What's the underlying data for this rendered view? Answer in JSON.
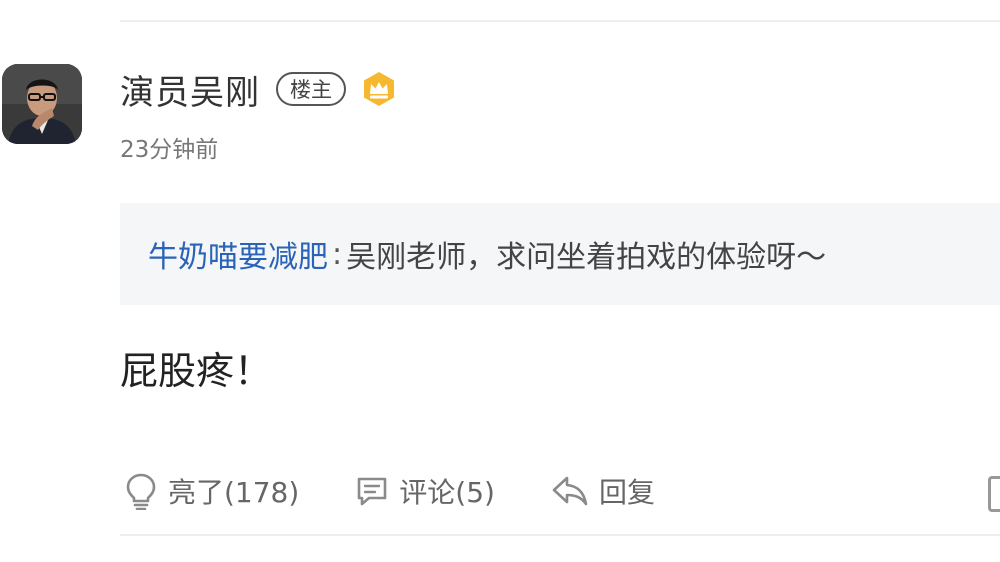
{
  "post": {
    "author": {
      "name": "演员吴刚",
      "op_badge": "楼主",
      "crown_badge_icon": "crown-icon",
      "avatar_icon": "avatar"
    },
    "timestamp": "23分钟前",
    "quote": {
      "user": "牛奶喵要减肥",
      "separator": ":",
      "text": "吴刚老师，求问坐着拍戏的体验呀～"
    },
    "body": "屁股疼！",
    "actions": {
      "like_icon": "lightbulb-icon",
      "like_label": "亮了(178)",
      "comment_icon": "comment-icon",
      "comment_label": "评论(5)",
      "reply_icon": "reply-arrow-icon",
      "reply_label": "回复"
    }
  },
  "colors": {
    "accent_link": "#2a64b8",
    "crown_gold": "#f5b82e",
    "quote_background": "#f5f6f8"
  }
}
